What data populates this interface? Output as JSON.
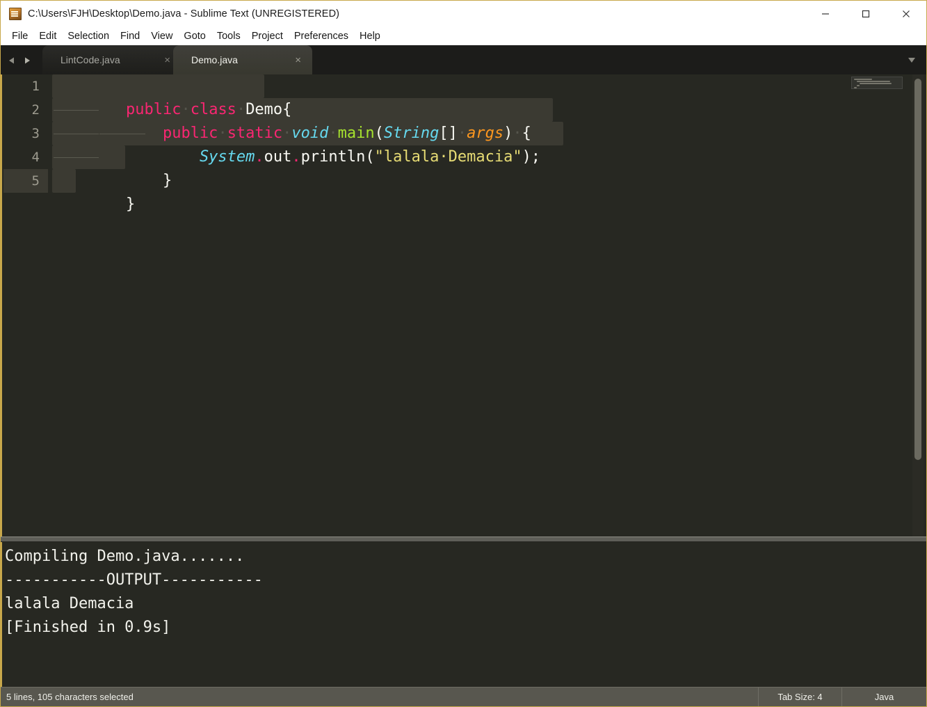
{
  "window": {
    "title": "C:\\Users\\FJH\\Desktop\\Demo.java - Sublime Text (UNREGISTERED)",
    "icon": "sublime-text-icon",
    "controls": {
      "minimize": "minimize-icon",
      "maximize": "maximize-icon",
      "close": "close-icon"
    }
  },
  "menubar": {
    "items": [
      {
        "label": "File"
      },
      {
        "label": "Edit"
      },
      {
        "label": "Selection"
      },
      {
        "label": "Find"
      },
      {
        "label": "View"
      },
      {
        "label": "Goto"
      },
      {
        "label": "Tools"
      },
      {
        "label": "Project"
      },
      {
        "label": "Preferences"
      },
      {
        "label": "Help"
      }
    ]
  },
  "tabbar": {
    "prev_icon": "arrow-left-icon",
    "next_icon": "arrow-right-icon",
    "menu_icon": "chevron-down-icon",
    "close_glyph": "×",
    "tabs": [
      {
        "label": "LintCode.java",
        "active": false
      },
      {
        "label": "Demo.java",
        "active": true
      }
    ]
  },
  "editor": {
    "gutter": [
      "1",
      "2",
      "3",
      "4",
      "5"
    ],
    "current_line": 5,
    "lines": [
      {
        "n": 1,
        "text": "public class Demo{"
      },
      {
        "n": 2,
        "text": "\tpublic static void main(String[] args) {"
      },
      {
        "n": 3,
        "text": "\t\tSystem.out.println(\"lalala Demacia\");"
      },
      {
        "n": 4,
        "text": "\t}"
      },
      {
        "n": 5,
        "text": "}"
      }
    ],
    "tokens": {
      "line1": [
        "public",
        "class",
        "Demo{"
      ],
      "line2": [
        "public",
        "static",
        "void",
        "main",
        "String",
        "[]",
        "args",
        ") {"
      ],
      "line3": [
        "System",
        "out",
        "println",
        "\"lalala Demacia\"",
        ");"
      ],
      "line4": [
        "}"
      ],
      "line5": [
        "}"
      ]
    }
  },
  "console": {
    "lines": [
      "Compiling Demo.java.......",
      "-----------OUTPUT-----------",
      "lalala Demacia",
      "[Finished in 0.9s]"
    ]
  },
  "statusbar": {
    "selection": "5 lines, 105 characters selected",
    "tab_size": "Tab Size: 4",
    "syntax": "Java"
  },
  "colors": {
    "background": "#272822",
    "keyword": "#f92672",
    "type": "#66d9ef",
    "function": "#a6e22e",
    "parameter": "#fd971f",
    "string": "#e6db74",
    "text": "#f8f8f2",
    "selection": "#3b3a32",
    "accent_border": "#c8a84b",
    "statusbar": "#58574f"
  }
}
